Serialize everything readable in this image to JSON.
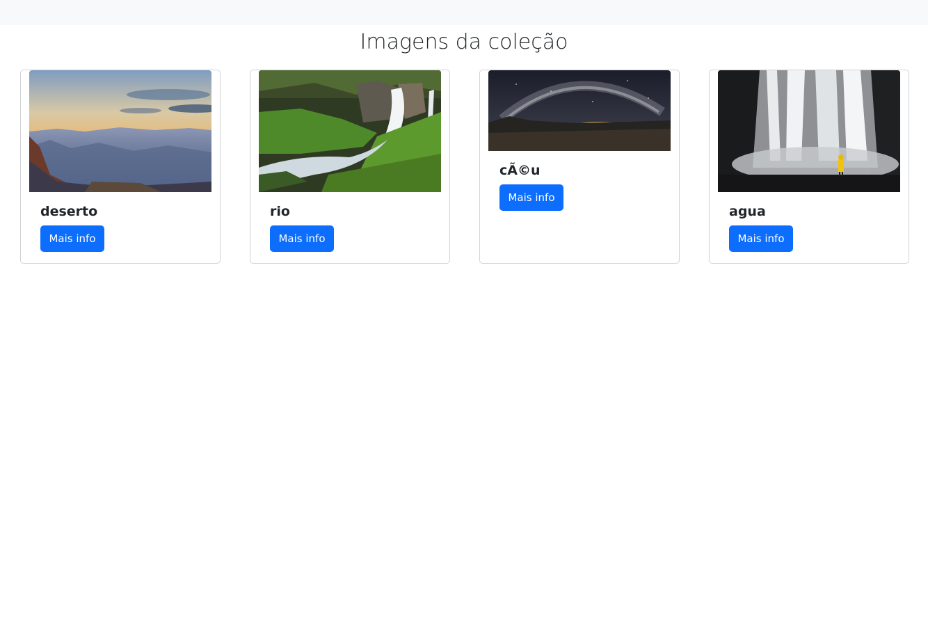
{
  "header": {
    "title": "Imagens da coleção"
  },
  "cards": [
    {
      "title": "deserto",
      "button_label": "Mais info",
      "image": "canyon-landscape"
    },
    {
      "title": "rio",
      "button_label": "Mais info",
      "image": "waterfall-forest"
    },
    {
      "title": "cÃ©u",
      "button_label": "Mais info",
      "image": "milky-way-night-sky"
    },
    {
      "title": "agua",
      "button_label": "Mais info",
      "image": "waterfall-person-yellow-coat"
    }
  ],
  "colors": {
    "topbar": "#f8f9fa",
    "primary_button": "#0d6efd",
    "card_border": "#d0d3d6"
  }
}
